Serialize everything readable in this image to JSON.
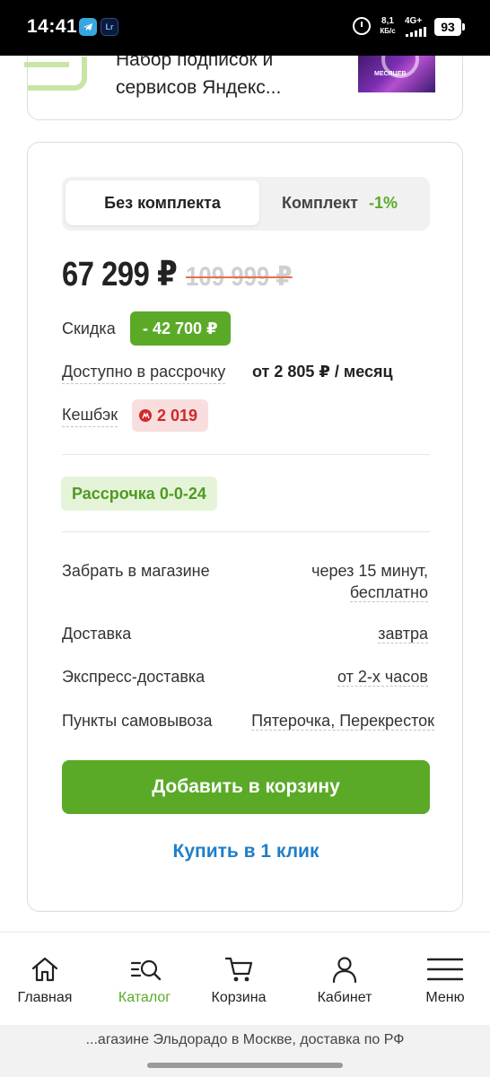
{
  "status_bar": {
    "time": "14:41",
    "app_icons": [
      "telegram-icon",
      "lightroom-icon"
    ],
    "lightroom_label": "Lr",
    "speed_value": "8,1",
    "speed_unit": "КБ/с",
    "network": "4G+",
    "battery": "93"
  },
  "top_card": {
    "title": "Набор подписок и сервисов Яндекс...",
    "image_caption": "МЕСЯЦЕВ"
  },
  "bundle_toggle": {
    "without_label": "Без комплекта",
    "with_label": "Комплект",
    "with_discount": "-1%",
    "selected": "without"
  },
  "price": {
    "current": "67 299 ₽",
    "old": "109 999 ₽"
  },
  "discount": {
    "label": "Скидка",
    "value": "- 42 700 ₽"
  },
  "installment": {
    "label": "Доступно в рассрочку",
    "value": "от 2 805 ₽ / месяц"
  },
  "cashback": {
    "label": "Кешбэк",
    "value": "2 019"
  },
  "plan_badge": "Рассрочка 0-0-24",
  "delivery": [
    {
      "label": "Забрать в магазине",
      "value_line1": "через 15 минут,",
      "value_line2": "бесплатно"
    },
    {
      "label": "Доставка",
      "value": "завтра"
    },
    {
      "label": "Экспресс-доставка",
      "value": "от 2-х часов"
    },
    {
      "label": "Пункты самовывоза",
      "value": "Пятерочка, Перекресток"
    }
  ],
  "actions": {
    "add_to_cart": "Добавить в корзину",
    "buy_one_click": "Купить в 1 клик"
  },
  "bottom_nav": {
    "items": [
      {
        "label": "Главная",
        "icon": "home-icon"
      },
      {
        "label": "Каталог",
        "icon": "catalog-search-icon",
        "active": true
      },
      {
        "label": "Корзина",
        "icon": "cart-icon"
      },
      {
        "label": "Кабинет",
        "icon": "user-icon"
      },
      {
        "label": "Меню",
        "icon": "menu-icon"
      }
    ]
  },
  "browser_url_text": "...агазине Эльдорадо в Москве, доставка по РФ",
  "colors": {
    "accent_green": "#5aaa28",
    "link_blue": "#1f7ec8",
    "cashback_red": "#d22828",
    "strike_orange": "#e8704a"
  }
}
